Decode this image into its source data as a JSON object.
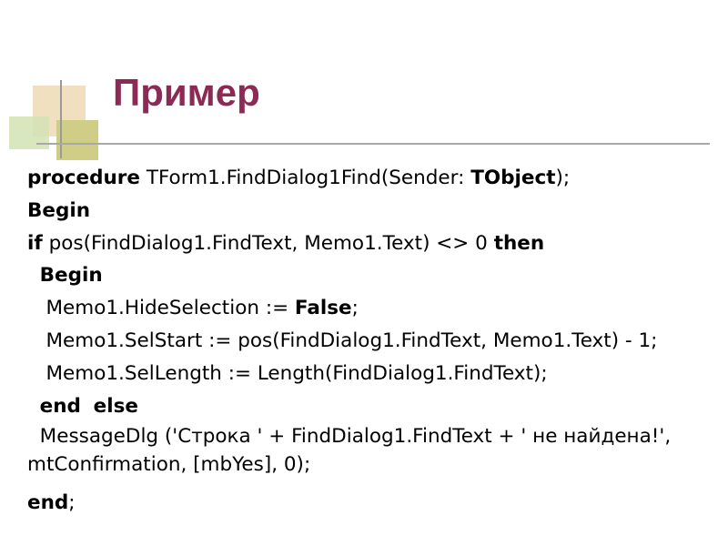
{
  "slide": {
    "title": "Пример"
  },
  "code": {
    "l1": {
      "kw": "procedure",
      "t1": " TForm1.FindDialog1Find(Sender: ",
      "kw2": "TObject",
      "t2": ");"
    },
    "l2": {
      "kw": "Begin"
    },
    "l3": {
      "kw": "if",
      "t1": " pos(FindDialog1.FindText, Memo1.Text) <> 0 ",
      "kw2": "then"
    },
    "l4": {
      "indent": "  ",
      "kw": "Begin"
    },
    "l5": {
      "t1": "   Memo1.HideSelection := ",
      "kw": "False",
      "t2": ";"
    },
    "l6": {
      "t1": "   Memo1.SelStart := pos(FindDialog1.FindText, Memo1.Text) - 1;"
    },
    "l7": {
      "t1": "   Memo1.SelLength := Length(FindDialog1.FindText);"
    },
    "l8": {
      "indent": "  ",
      "kw": "end",
      "sep": "  ",
      "kw2": "else"
    },
    "l9a": "  MessageDlg ('Строка ' + FindDialog1.FindText + ' не найдена!',",
    "l9b": "mtConfirmation, [mbYes], 0);",
    "l10": {
      "kw": "end",
      "t1": ";"
    }
  }
}
